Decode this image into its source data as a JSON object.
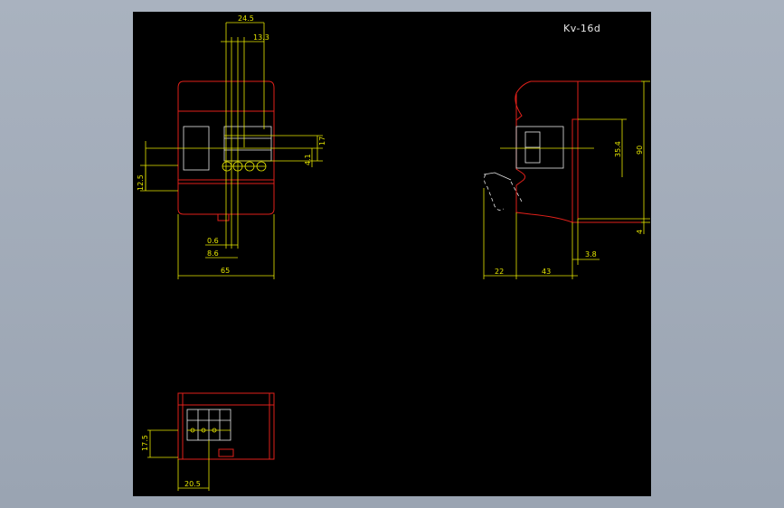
{
  "drawing": {
    "title": "Kv-16d",
    "dimensions": {
      "d_24_5": "24.5",
      "d_13_3": "13.3",
      "d_17": "17",
      "d_4_1": "4.1",
      "d_12_5": "12.5",
      "d_0_6": "0.6",
      "d_8_6": "8.6",
      "d_65": "65",
      "d_35_4": "35.4",
      "d_90": "90",
      "d_4": "4",
      "d_3_8": "3.8",
      "d_22": "22",
      "d_43": "43",
      "d_17_5": "17.5",
      "d_20_5": "20.5"
    }
  },
  "colors": {
    "background": "#9aa4b2",
    "canvas": "#000000",
    "outline": "#e0201a",
    "dimension": "#e6e600",
    "detail": "#e8e8e8"
  }
}
